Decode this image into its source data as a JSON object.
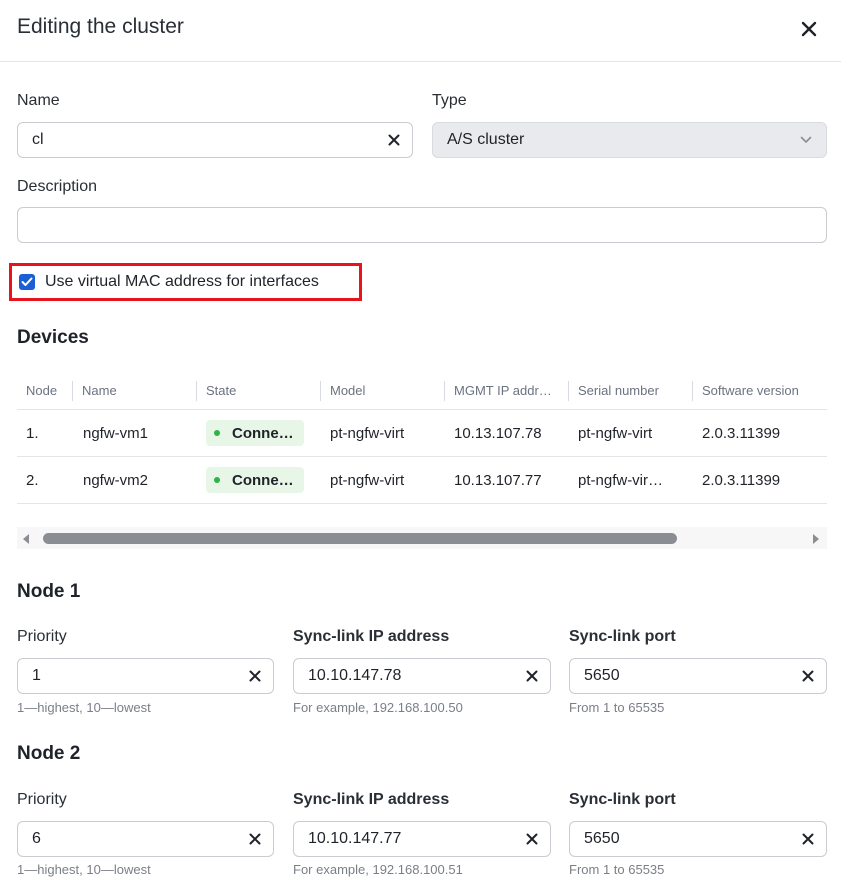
{
  "dialog": {
    "title": "Editing the cluster"
  },
  "form": {
    "name_label": "Name",
    "name_value": "cl",
    "type_label": "Type",
    "type_value": "A/S cluster",
    "description_label": "Description",
    "description_value": "",
    "virtual_mac_label": "Use virtual MAC address for interfaces",
    "virtual_mac_checked": true
  },
  "devices": {
    "title": "Devices",
    "columns": [
      "Node",
      "Name",
      "State",
      "Model",
      "MGMT IP addr…",
      "Serial number",
      "Software version"
    ],
    "rows": [
      {
        "node": "1.",
        "name": "ngfw-vm1",
        "state": "Conne…",
        "model": "pt-ngfw-virt",
        "ip": "10.13.107.78",
        "serial": "pt-ngfw-virt",
        "version": "2.0.3.11399"
      },
      {
        "node": "2.",
        "name": "ngfw-vm2",
        "state": "Conne…",
        "model": "pt-ngfw-virt",
        "ip": "10.13.107.77",
        "serial": "pt-ngfw-vir…",
        "version": "2.0.3.11399"
      }
    ]
  },
  "node1": {
    "title": "Node 1",
    "priority_label": "Priority",
    "priority_value": "1",
    "priority_hint": "1—highest, 10—lowest",
    "ip_label": "Sync-link IP address",
    "ip_value": "10.10.147.78",
    "ip_hint": "For example, 192.168.100.50",
    "port_label": "Sync-link port",
    "port_value": "5650",
    "port_hint": "From 1 to 65535"
  },
  "node2": {
    "title": "Node 2",
    "priority_label": "Priority",
    "priority_value": "6",
    "priority_hint": "1—highest, 10—lowest",
    "ip_label": "Sync-link IP address",
    "ip_value": "10.10.147.77",
    "ip_hint": "For example, 192.168.100.51",
    "port_label": "Sync-link port",
    "port_value": "5650",
    "port_hint": "From 1 to 65535"
  },
  "colors": {
    "accent": "#1a5fd6",
    "highlight_border": "#e8131b",
    "status_connected": "#2fb344",
    "status_badge_bg": "#e8f6e8"
  },
  "icons": {
    "close": "close-icon",
    "clear": "clear-icon",
    "chevron": "chevron-down-icon",
    "check": "check-icon",
    "status": "status-dot-icon",
    "scroll_left": "arrow-left-icon",
    "scroll_right": "arrow-right-icon"
  }
}
